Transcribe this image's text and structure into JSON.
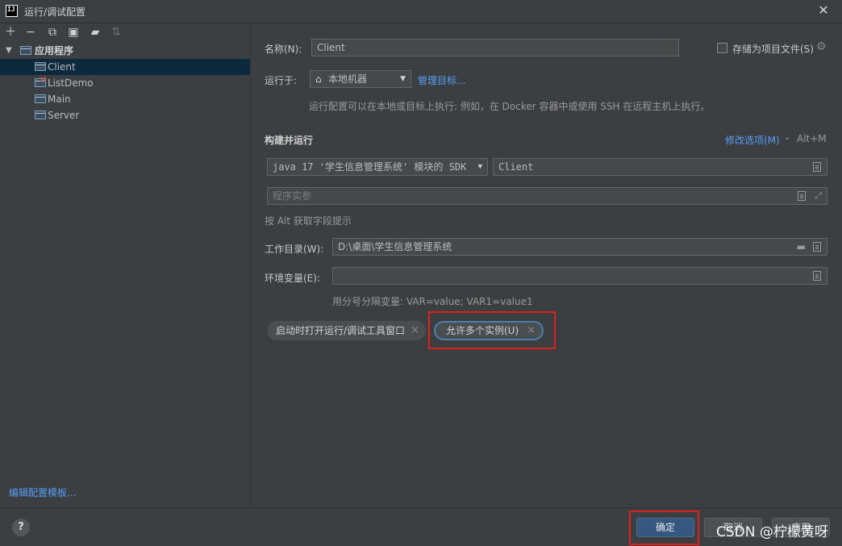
{
  "window": {
    "title": "运行/调试配置",
    "logo": "IJ"
  },
  "toolbar": {
    "icons": [
      "plus-icon",
      "minus-icon",
      "copy-icon",
      "save-icon",
      "folder-add-icon",
      "sort-icon"
    ]
  },
  "tree": {
    "root_label": "应用程序",
    "items": [
      {
        "label": "Client",
        "selected": true,
        "error": false
      },
      {
        "label": "ListDemo",
        "selected": false,
        "error": true
      },
      {
        "label": "Main",
        "selected": false,
        "error": false
      },
      {
        "label": "Server",
        "selected": false,
        "error": false
      }
    ],
    "edit_templates": "编辑配置模板..."
  },
  "form": {
    "name_label": "名称(N):",
    "name_value": "Client",
    "store_as_project_file": "存储为项目文件(S)",
    "run_on_label": "运行于:",
    "run_on_value": "本地机器",
    "manage_targets": "管理目标...",
    "run_on_hint": "运行配置可以在本地或目标上执行: 例如，在 Docker 容器中或使用 SSH 在远程主机上执行。",
    "build_run_title": "构建并运行",
    "modify_options": "修改选项(M)",
    "modify_shortcut": "Alt+M",
    "sdk_value": "java 17 '学生信息管理系统' 模块的 SDK",
    "main_class_value": "Client",
    "program_args_placeholder": "程序实参",
    "alt_hint": "按 Alt 获取字段提示",
    "workdir_label": "工作目录(W):",
    "workdir_value": "D:\\桌面\\学生信息管理系统",
    "env_label": "环境变量(E):",
    "env_value": "",
    "env_hint": "用分号分隔变量: VAR=value; VAR1=value1",
    "chip_1": "启动时打开运行/调试工具窗口",
    "chip_2": "允许多个实例(U)"
  },
  "buttons": {
    "help": "?",
    "ok": "确定",
    "cancel": "取消",
    "apply": "应用"
  },
  "watermark": "CSDN @柠檬黄呀",
  "colors": {
    "accent": "#589df6",
    "selection": "#0d293e",
    "highlight_box": "#e0201c",
    "ok_button": "#365880"
  }
}
